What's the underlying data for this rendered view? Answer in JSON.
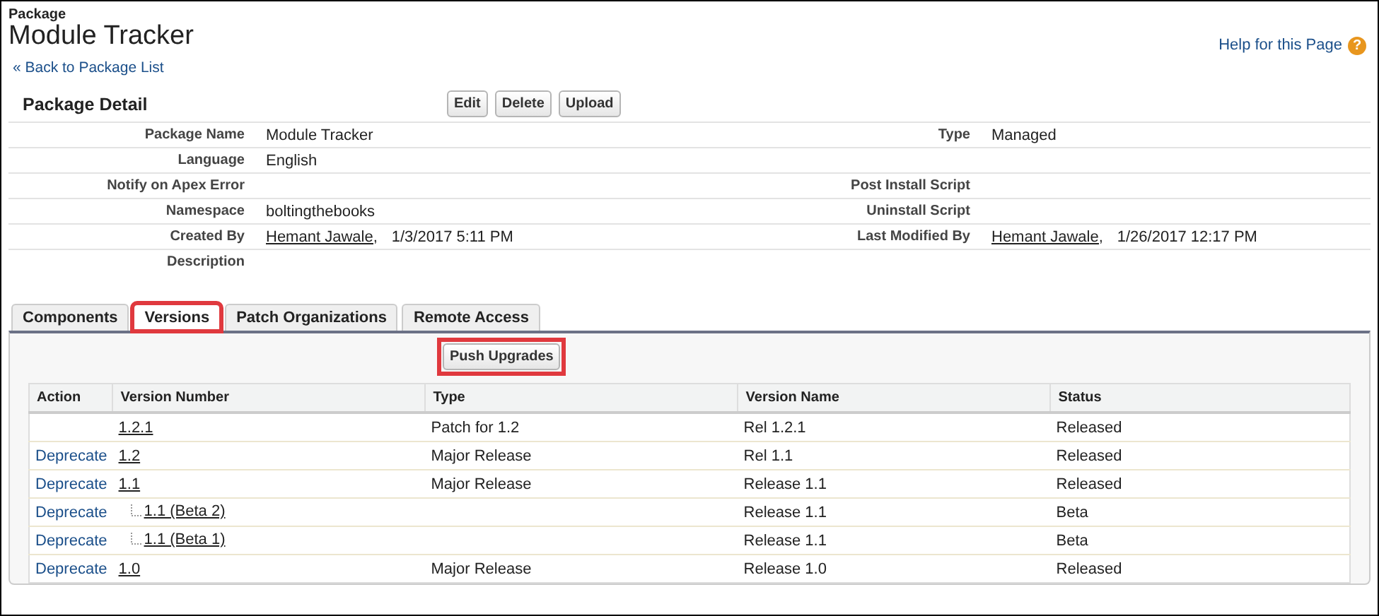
{
  "header": {
    "eyebrow": "Package",
    "title": "Module Tracker",
    "back_link": "« Back to Package List",
    "help_link": "Help for this Page",
    "help_icon": "?"
  },
  "detail": {
    "title": "Package Detail",
    "buttons": [
      "Edit",
      "Delete",
      "Upload"
    ],
    "fields": [
      {
        "label": "Package Name",
        "value": "Module Tracker",
        "right_label": "Type",
        "right_value": "Managed"
      },
      {
        "label": "Language",
        "value": "English"
      },
      {
        "label": "Notify on Apex Error",
        "right_label": "Post Install Script"
      },
      {
        "label": "Namespace",
        "value": "boltingthebooks",
        "right_label": "Uninstall Script"
      },
      {
        "label": "Created By",
        "link": "Hemant Jawale,",
        "value": "1/3/2017 5:11 PM",
        "right_label": "Last Modified By",
        "right_link": "Hemant Jawale,",
        "right_value": "1/26/2017 12:17 PM"
      },
      {
        "label": "Description"
      }
    ]
  },
  "tabs": [
    {
      "label": "Components",
      "selected": false,
      "highlighted": false
    },
    {
      "label": "Versions",
      "selected": true,
      "highlighted": true
    },
    {
      "label": "Patch Organizations",
      "selected": false,
      "highlighted": false
    },
    {
      "label": "Remote Access",
      "selected": false,
      "highlighted": false
    }
  ],
  "push_button": {
    "label": "Push Upgrades",
    "highlighted": true
  },
  "table": {
    "columns": [
      "Action",
      "Version Number",
      "Type",
      "Version Name",
      "Status"
    ],
    "rows": [
      {
        "action": "",
        "version": "1.2.1",
        "type": "Patch for 1.2",
        "name": "Rel 1.2.1",
        "status": "Released"
      },
      {
        "action": "Deprecate",
        "version": "1.2",
        "type": "Major Release",
        "name": "Rel 1.1",
        "status": "Released"
      },
      {
        "action": "Deprecate",
        "version": "1.1",
        "type": "Major Release",
        "name": "Release 1.1",
        "status": "Released",
        "children": [
          {
            "action": "Deprecate",
            "version": "1.1 (Beta 2)",
            "name": "Release 1.1",
            "status": "Beta"
          },
          {
            "action": "Deprecate",
            "version": "1.1 (Beta 1)",
            "name": "Release 1.1",
            "status": "Beta"
          }
        ]
      },
      {
        "action": "Deprecate",
        "version": "1.0",
        "type": "Major Release",
        "name": "Release 1.0",
        "status": "Released"
      }
    ]
  }
}
